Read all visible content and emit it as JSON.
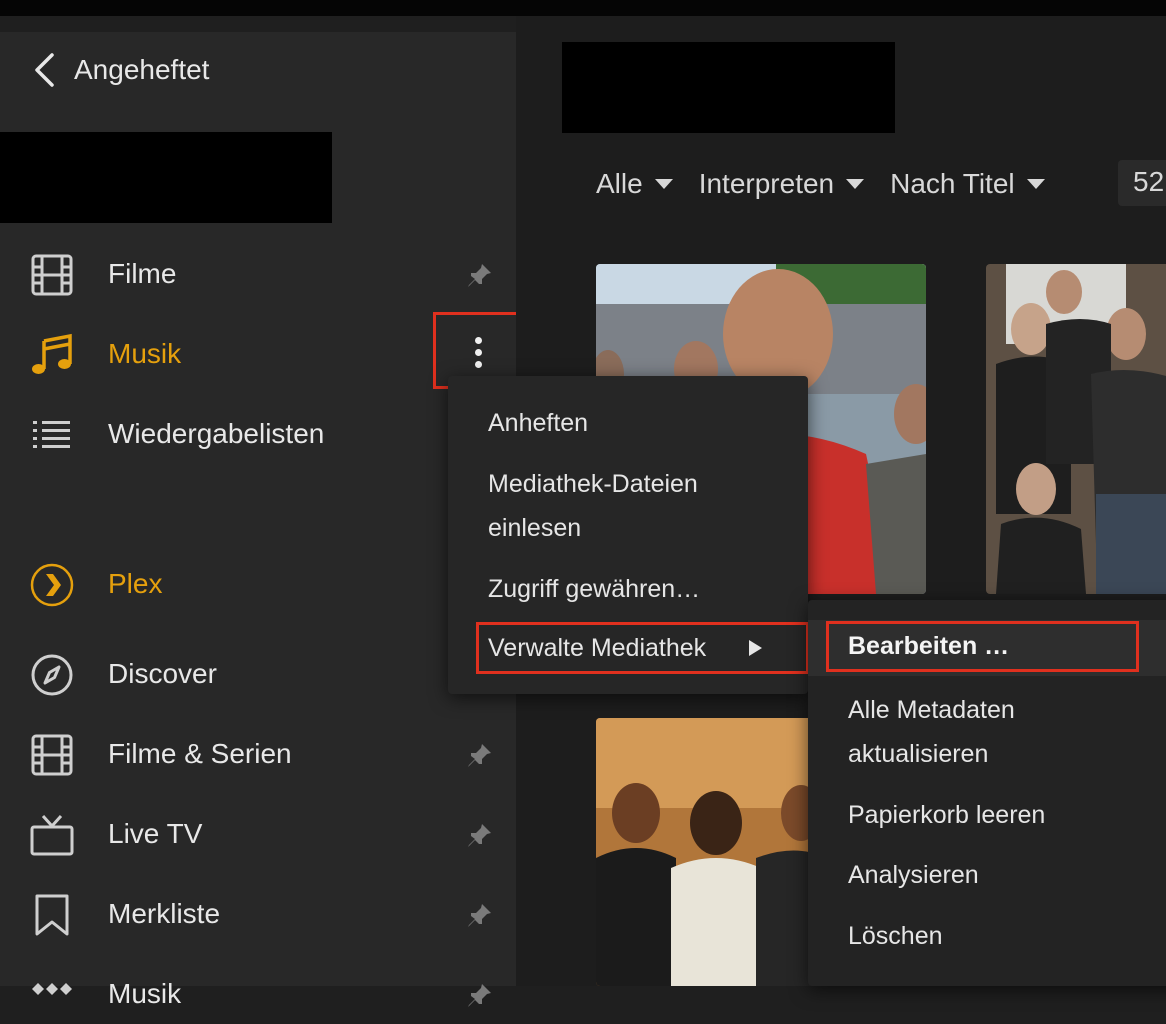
{
  "sidebar": {
    "header_label": "Angeheftet",
    "items": [
      {
        "label": "Filme",
        "icon": "film-icon",
        "pinned": true
      },
      {
        "label": "Musik",
        "icon": "music-note-icon",
        "active": true
      },
      {
        "label": "Wiedergabelisten",
        "icon": "list-icon"
      },
      {
        "label": "Plex",
        "icon": "plex-chevron-icon",
        "brand": true
      },
      {
        "label": "Discover",
        "icon": "compass-icon"
      },
      {
        "label": "Filme & Serien",
        "icon": "film-icon",
        "pinned": true
      },
      {
        "label": "Live TV",
        "icon": "tv-icon",
        "pinned": true
      },
      {
        "label": "Merkliste",
        "icon": "bookmark-icon",
        "pinned": true
      },
      {
        "label": "Musik",
        "icon": "tidal-icon",
        "pinned": true
      }
    ]
  },
  "filters": {
    "type": "Alle",
    "view": "Interpreten",
    "sort": "Nach Titel",
    "count": "52"
  },
  "context_menu": {
    "items": [
      "Anheften",
      "Mediathek-Dateien",
      "einlesen",
      "Zugriff gewähren…",
      "Verwalte Mediathek"
    ]
  },
  "submenu": {
    "items": [
      "Bearbeiten …",
      "Alle Metadaten",
      "aktualisieren",
      "Papierkorb leeren",
      "Analysieren",
      "Löschen"
    ]
  },
  "colors": {
    "accent": "#e5a00d",
    "highlight_border": "#e0301e",
    "background": "#1f1f1f",
    "sidebar": "#282828"
  }
}
